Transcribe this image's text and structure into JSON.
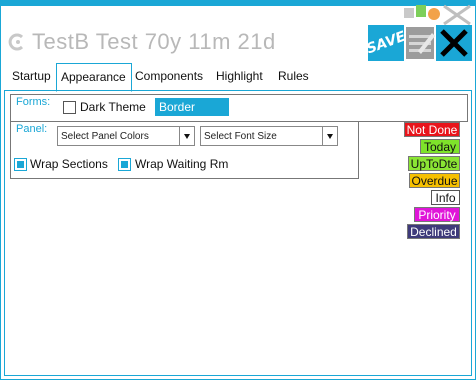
{
  "title": "TestB Test 70y 11m 21d",
  "toolbar": {
    "save_label": "SAVE",
    "edit_icon": "edit-icon",
    "close_icon": "close-icon"
  },
  "tabs": [
    {
      "label": "Startup"
    },
    {
      "label": "Appearance",
      "active": true
    },
    {
      "label": "Components"
    },
    {
      "label": "Highlight"
    },
    {
      "label": "Rules"
    }
  ],
  "forms": {
    "legend": "Forms:",
    "dark_theme_label": "Dark Theme",
    "dark_theme_checked": false,
    "border_label": "Border"
  },
  "panel": {
    "legend": "Panel:",
    "panel_colors_placeholder": "Select Panel Colors",
    "font_size_placeholder": "Select  Font Size",
    "wrap_sections_label": "Wrap Sections",
    "wrap_sections_checked": true,
    "wrap_waiting_label": "Wrap Waiting Rm",
    "wrap_waiting_checked": true
  },
  "status_legend": [
    {
      "label": "Not Done",
      "bg": "#e8141b",
      "fg": "#ffffff"
    },
    {
      "label": "Today",
      "bg": "#7ee32a",
      "fg": "#111111"
    },
    {
      "label": "UpToDte",
      "bg": "#8be534",
      "fg": "#111111"
    },
    {
      "label": "Overdue",
      "bg": "#f6c000",
      "fg": "#111111"
    },
    {
      "label": "Info",
      "bg": "#ffffff",
      "fg": "#111111"
    },
    {
      "label": "Priority",
      "bg": "#e015d9",
      "fg": "#ffffff"
    },
    {
      "label": "Declined",
      "bg": "#3e3a7a",
      "fg": "#ffffff"
    }
  ],
  "colors": {
    "accent": "#1aa7d6"
  }
}
